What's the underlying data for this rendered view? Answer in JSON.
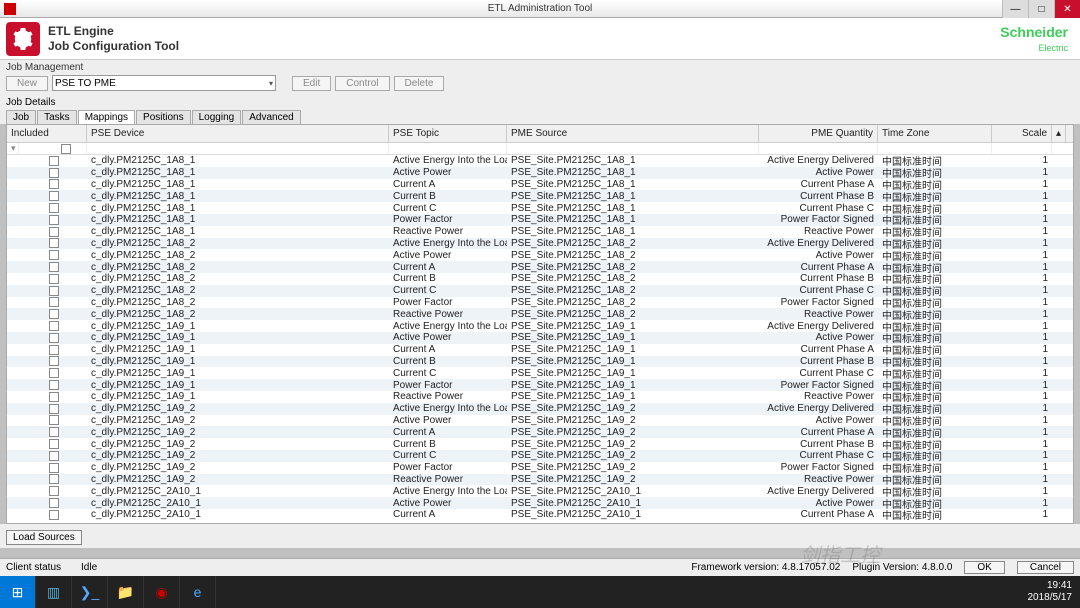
{
  "window": {
    "title": "ETL Administration Tool"
  },
  "header": {
    "line1": "ETL Engine",
    "line2": "Job Configuration Tool"
  },
  "brand": {
    "name": "Schneider",
    "sub": "Electric"
  },
  "jobmgmt": {
    "label": "Job Management",
    "new": "New",
    "combo": "PSE TO PME",
    "edit": "Edit",
    "control": "Control",
    "delete": "Delete"
  },
  "jobdet": {
    "label": "Job Details"
  },
  "tabs": [
    "Job",
    "Tasks",
    "Mappings",
    "Positions",
    "Logging",
    "Advanced"
  ],
  "active_tab": 2,
  "columns": [
    "Included",
    "PSE Device",
    "PSE Topic",
    "PME Source",
    "PME Quantity",
    "Time Zone",
    "Scale"
  ],
  "timezone": "中国标准时间",
  "topics": {
    "aeil": "Active Energy Into the Load",
    "ap": "Active Power",
    "ca": "Current A",
    "cb": "Current B",
    "cc": "Current C",
    "pf": "Power Factor",
    "rp": "Reactive Power"
  },
  "qty": {
    "aed": "Active Energy Delivered",
    "ap": "Active Power",
    "cpa": "Current Phase A",
    "cpb": "Current Phase B",
    "cpc": "Current Phase C",
    "pfs": "Power Factor Signed",
    "rp": "Reactive Power"
  },
  "devices": [
    {
      "suffix": "1A8_1",
      "rows": [
        "aeil",
        "ap",
        "ca",
        "cb",
        "cc",
        "pf",
        "rp"
      ]
    },
    {
      "suffix": "1A8_2",
      "rows": [
        "aeil",
        "ap",
        "ca",
        "cb",
        "cc",
        "pf",
        "rp"
      ]
    },
    {
      "suffix": "1A9_1",
      "rows": [
        "aeil",
        "ap",
        "ca",
        "cb",
        "cc",
        "pf",
        "rp"
      ]
    },
    {
      "suffix": "1A9_2",
      "rows": [
        "aeil",
        "ap",
        "ca",
        "cb",
        "cc",
        "pf",
        "rp"
      ]
    },
    {
      "suffix": "2A10_1",
      "rows": [
        "aeil",
        "ap",
        "ca"
      ]
    }
  ],
  "qmap": {
    "aeil": "aed",
    "ap": "ap",
    "ca": "cpa",
    "cb": "cpb",
    "cc": "cpc",
    "pf": "pfs",
    "rp": "rp"
  },
  "device_prefix": "c_dly.PM2125C_",
  "source_prefix": "PSE_Site.PM2125C_",
  "scale_default": "1",
  "load_sources": "Load Sources",
  "footer": {
    "client": "Client status",
    "idle": "Idle",
    "fw": "Framework version: 4.8.17057.02",
    "plugin": "Plugin Version: 4.8.0.0",
    "ok": "OK",
    "cancel": "Cancel"
  },
  "tray": {
    "time": "19:41",
    "date": "2018/5/17"
  },
  "watermark": "剑指工控"
}
